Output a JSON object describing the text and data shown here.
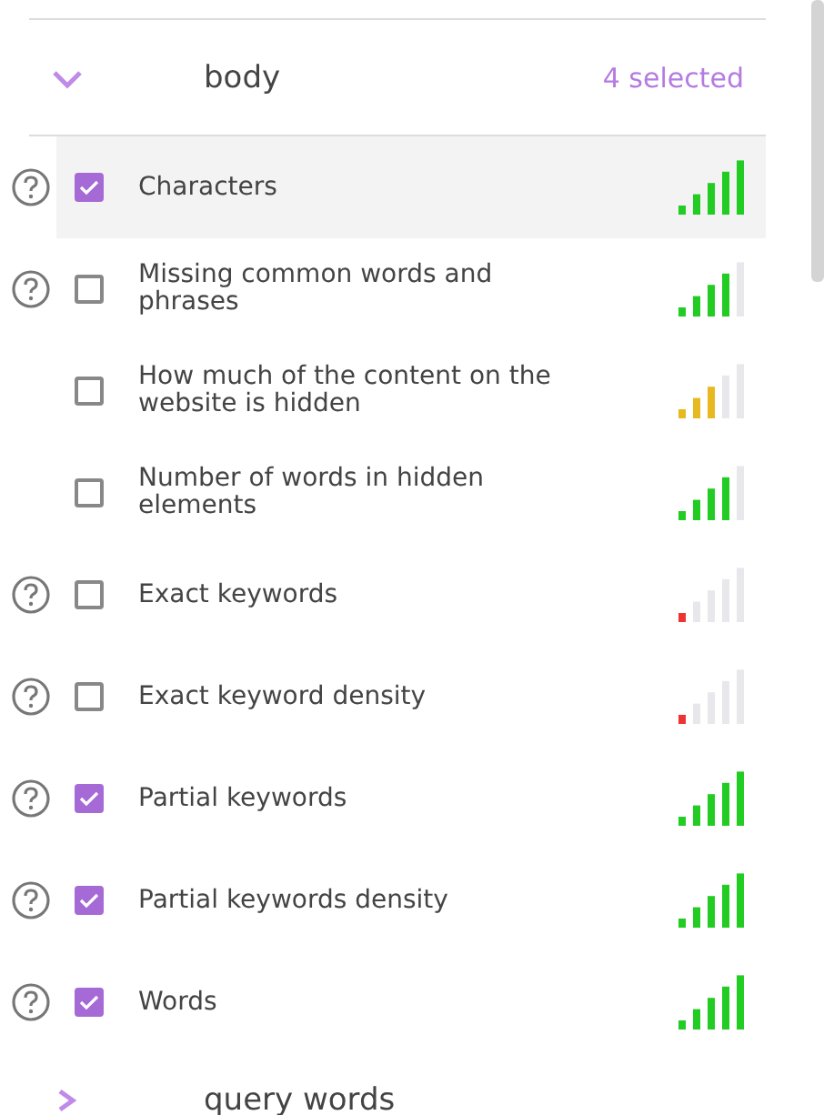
{
  "section": {
    "title": "body",
    "expanded": true,
    "count": "4 selected"
  },
  "rows": [
    {
      "label": "Characters",
      "help_icon": true,
      "checked": true,
      "highlighted": true,
      "level": 1,
      "color": "#22cc22"
    },
    {
      "label": "Missing common words and phrases",
      "help_icon": true,
      "checked": false,
      "highlighted": false,
      "level": 0.8,
      "color": "#22cc22"
    },
    {
      "label": "How much of the content on the website is hidden",
      "help_icon": false,
      "checked": false,
      "highlighted": false,
      "level": 0.6,
      "color": "#e8b820"
    },
    {
      "label": "Number of words in hidden elements",
      "help_icon": false,
      "checked": false,
      "highlighted": false,
      "level": 0.8,
      "color": "#22cc22"
    },
    {
      "label": "Exact keywords",
      "help_icon": true,
      "checked": false,
      "highlighted": false,
      "level": 0.2,
      "color": "#ee3333"
    },
    {
      "label": "Exact keyword density",
      "help_icon": true,
      "checked": false,
      "highlighted": false,
      "level": 0.2,
      "color": "#ee3333"
    },
    {
      "label": "Partial keywords",
      "help_icon": true,
      "checked": true,
      "highlighted": false,
      "level": 1,
      "color": "#22cc22"
    },
    {
      "label": "Partial keywords density",
      "help_icon": true,
      "checked": true,
      "highlighted": false,
      "level": 1,
      "color": "#22cc22"
    },
    {
      "label": "Words",
      "help_icon": true,
      "checked": true,
      "highlighted": false,
      "level": 1,
      "color": "#22cc22"
    }
  ],
  "next_section": {
    "title": "query words",
    "expanded": false
  }
}
